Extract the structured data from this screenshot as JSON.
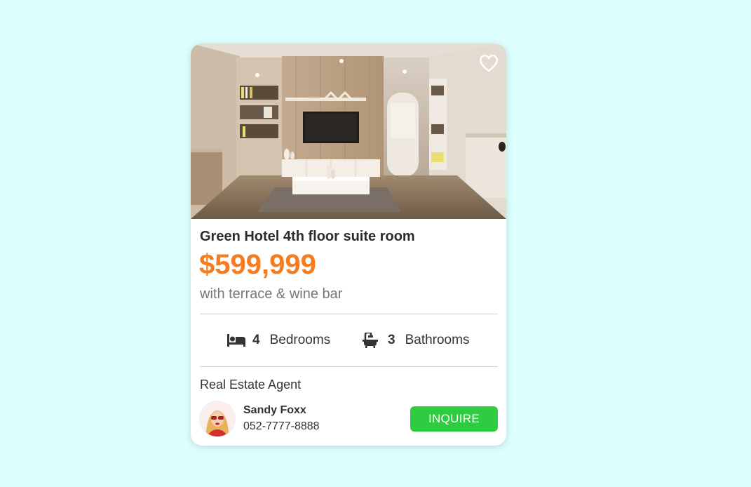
{
  "listing": {
    "title": "Green Hotel 4th floor suite room",
    "price": "$599,999",
    "subtitle": "with terrace & wine bar",
    "favorite_icon": "heart-outline-icon",
    "photo_description_icon": "room-photo",
    "features": [
      {
        "icon": "bed-icon",
        "count": "4",
        "label": "Bedrooms"
      },
      {
        "icon": "bathtub-icon",
        "count": "3",
        "label": "Bathrooms"
      }
    ]
  },
  "agent": {
    "heading": "Real Estate Agent",
    "name": "Sandy Foxx",
    "phone": "052-7777-8888",
    "button_label": "INQUIRE"
  },
  "colors": {
    "page_background": "#dcfffe",
    "card_background": "#ffffff",
    "price": "#f57c1f",
    "button": "#2ecc40",
    "text_dark": "#2b2b2b",
    "text_muted": "#777777"
  }
}
